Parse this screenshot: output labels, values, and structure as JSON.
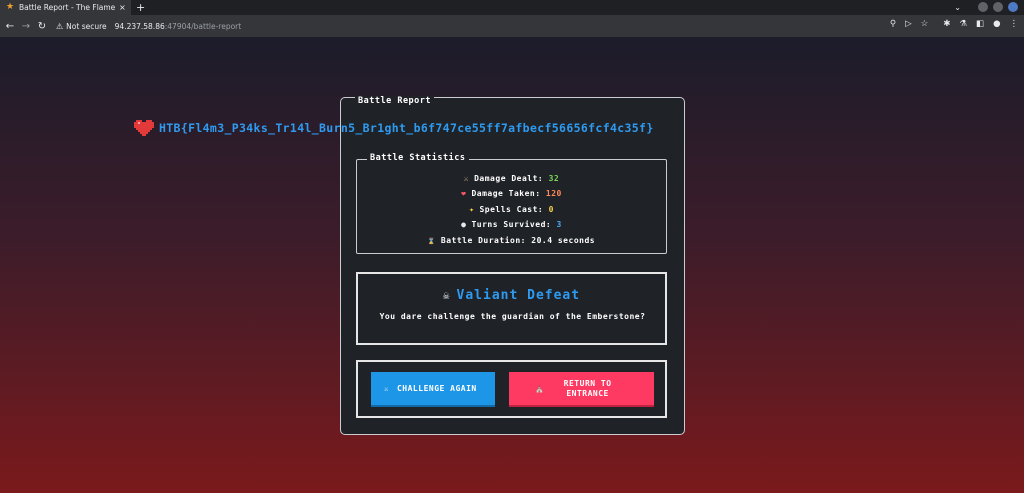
{
  "browser": {
    "tab_title": "Battle Report - The Flame",
    "tab_close": "×",
    "new_tab": "+",
    "not_secure": "Not secure",
    "url_host": "94.237.58.86",
    "url_rest": ":47904/battle-report"
  },
  "page": {
    "card_title": "Battle Report",
    "flag": "HTB{Fl4m3_P34ks_Tr14l_Burn5_Br1ght_b6f747ce55ff7afbecf56656fcf4c35f}",
    "stats": {
      "legend": "Battle Statistics",
      "damage_dealt_label": "Damage Dealt:",
      "damage_dealt_value": "32",
      "damage_taken_label": "Damage Taken:",
      "damage_taken_value": "120",
      "spells_cast_label": "Spells Cast:",
      "spells_cast_value": "0",
      "turns_survived_label": "Turns Survived:",
      "turns_survived_value": "3",
      "battle_duration_label": "Battle Duration:",
      "battle_duration_value": "20.4 seconds"
    },
    "result": {
      "title": "Valiant Defeat",
      "message": "You dare challenge the guardian of the Emberstone?"
    },
    "actions": {
      "challenge_again": "CHALLENGE AGAIN",
      "return_entrance": "RETURN TO ENTRANCE"
    }
  },
  "colors": {
    "accent_blue": "#2e9bf0",
    "button_blue": "#1e96e8",
    "button_red": "#ff3a62",
    "stat_green": "#7bd35a",
    "stat_orange": "#ff8a5a",
    "stat_yellow": "#f6d24a"
  },
  "icons": {
    "tab_favicon": "flame-icon",
    "damage_dealt": "sword-icon",
    "damage_taken": "heart-icon",
    "spells_cast": "sparkle-icon",
    "turns_survived": "moon-icon",
    "battle_duration": "hourglass-icon",
    "result": "skull-icon",
    "challenge_again": "swords-icon",
    "return_entrance": "castle-icon"
  }
}
